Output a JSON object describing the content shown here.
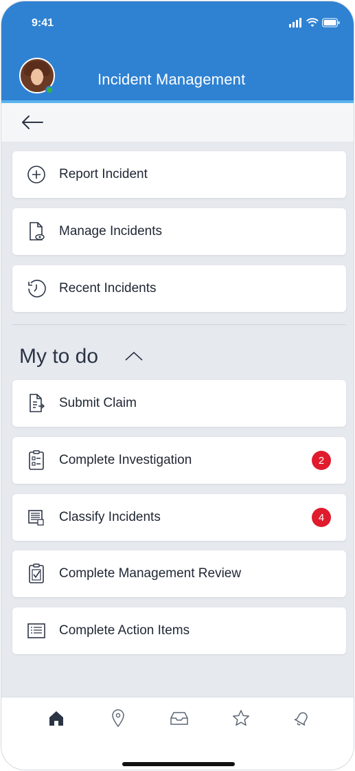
{
  "status_bar": {
    "time": "9:41"
  },
  "header": {
    "title": "Incident Management"
  },
  "menu": [
    {
      "label": "Report Incident",
      "icon": "plus-circle-icon"
    },
    {
      "label": "Manage Incidents",
      "icon": "document-eye-icon"
    },
    {
      "label": "Recent Incidents",
      "icon": "history-icon"
    }
  ],
  "todo": {
    "title": "My to do",
    "items": [
      {
        "label": "Submit Claim",
        "icon": "document-arrow-icon",
        "badge": ""
      },
      {
        "label": "Complete Investigation",
        "icon": "clipboard-list-icon",
        "badge": "2"
      },
      {
        "label": "Classify Incidents",
        "icon": "list-document-icon",
        "badge": "4"
      },
      {
        "label": "Complete Management Review",
        "icon": "clipboard-check-icon",
        "badge": ""
      },
      {
        "label": "Complete Action Items",
        "icon": "list-icon",
        "badge": ""
      }
    ]
  },
  "nav": [
    {
      "icon": "home-icon",
      "active": true
    },
    {
      "icon": "location-pin-icon",
      "active": false
    },
    {
      "icon": "inbox-icon",
      "active": false
    },
    {
      "icon": "star-icon",
      "active": false
    },
    {
      "icon": "bell-icon",
      "active": false
    }
  ],
  "colors": {
    "header": "#2f82d2",
    "accent": "#5ab3ee",
    "badge": "#e01b2d",
    "background": "#e6e9ee"
  }
}
